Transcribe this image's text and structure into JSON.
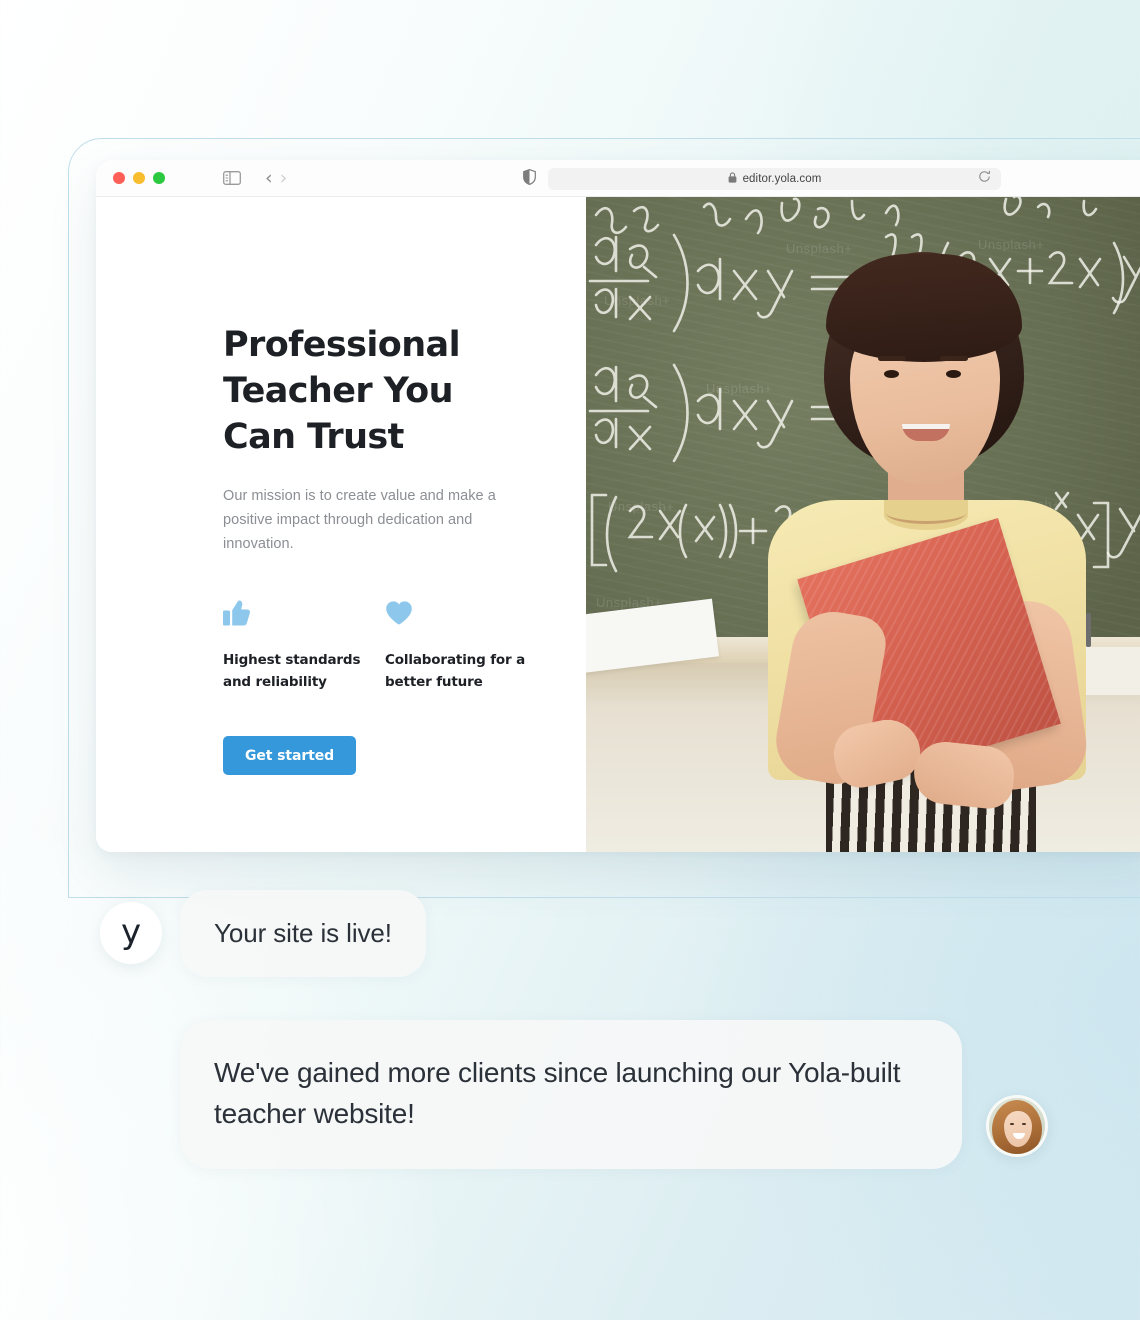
{
  "browser": {
    "traffic_lights": [
      "close",
      "minimize",
      "maximize"
    ],
    "sidebar_toggle_icon": "sidebar-toggle-icon",
    "back_icon": "chevron-left-icon",
    "forward_icon": "chevron-right-icon",
    "shield_icon": "shield-icon",
    "lock_icon": "lock-icon",
    "url": "editor.yola.com",
    "reload_icon": "reload-icon"
  },
  "hero": {
    "title_lines": [
      "Professional",
      "Teacher You",
      "Can Trust"
    ],
    "title": "Professional Teacher You Can Trust",
    "subtitle": "Our mission is to create value and make a positive impact through dedication and innovation.",
    "features": [
      {
        "icon": "thumbs-up-icon",
        "label": "Highest standards and reliability"
      },
      {
        "icon": "heart-icon",
        "label": "Collaborating for a better future"
      }
    ],
    "cta_label": "Get started",
    "photo_alt": "teacher-chalkboard-photo",
    "watermark": "Unsplash+"
  },
  "chat": {
    "messages": [
      {
        "avatar": "yola-logo-avatar",
        "avatar_glyph": "y",
        "text": "Your site is live!"
      },
      {
        "avatar": "customer-photo-avatar",
        "text": "We've gained more clients since launching our Yola-built teacher website!"
      }
    ]
  },
  "colors": {
    "accent": "#3498db",
    "feature_icon": "#8ec7ec",
    "heading": "#1d2025",
    "body_text": "#8b8e93",
    "frame_border": "#bfdeeb",
    "bubble_bg": "#f6f8f8",
    "chalkboard": "#6c7458"
  }
}
